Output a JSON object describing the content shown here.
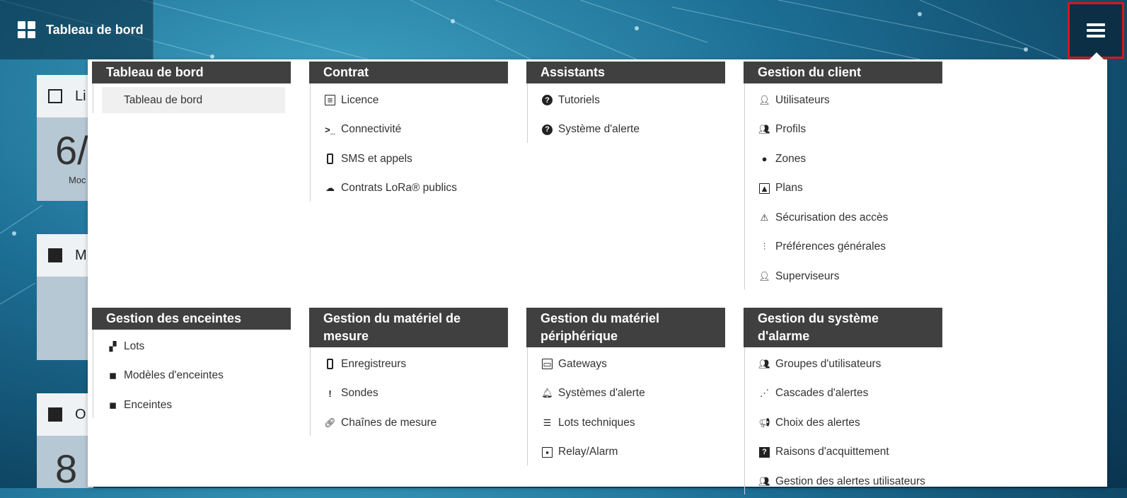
{
  "header": {
    "title": "Tableau de bord",
    "menu_icon": "hamburger-icon"
  },
  "background_cards": [
    {
      "label": "Li",
      "big": "6/",
      "sub": "Moc"
    },
    {
      "label": "M",
      "big": "",
      "sub": ""
    },
    {
      "label": "O",
      "big": "8",
      "sub": ""
    }
  ],
  "menu": {
    "sections": [
      {
        "title": "Tableau de bord",
        "items": [
          {
            "label": "Tableau de bord",
            "icon": "dashboard-icon",
            "active": true
          }
        ]
      },
      {
        "title": "Contrat",
        "items": [
          {
            "label": "Licence",
            "icon": "list-icon"
          },
          {
            "label": "Connectivité",
            "icon": "terminal-icon"
          },
          {
            "label": "SMS et appels",
            "icon": "phone-icon"
          },
          {
            "label": "Contrats LoRa® publics",
            "icon": "cloud-upload-icon"
          }
        ]
      },
      {
        "title": "Assistants",
        "items": [
          {
            "label": "Tutoriels",
            "icon": "question-icon"
          },
          {
            "label": "Système d'alerte",
            "icon": "question-icon"
          }
        ]
      },
      {
        "title": "Gestion du client",
        "items": [
          {
            "label": "Utilisateurs",
            "icon": "user-icon"
          },
          {
            "label": "Profils",
            "icon": "users-icon"
          },
          {
            "label": "Zones",
            "icon": "map-marker-icon"
          },
          {
            "label": "Plans",
            "icon": "image-icon"
          },
          {
            "label": "Sécurisation des accès",
            "icon": "warning-icon"
          },
          {
            "label": "Préférences générales",
            "icon": "sliders-icon"
          },
          {
            "label": "Superviseurs",
            "icon": "user-icon"
          }
        ]
      },
      {
        "title": "Gestion des enceintes",
        "items": [
          {
            "label": "Lots",
            "icon": "lots-icon"
          },
          {
            "label": "Modèles d'enceintes",
            "icon": "enclosure-icon"
          },
          {
            "label": "Enceintes",
            "icon": "enclosure-icon"
          }
        ]
      },
      {
        "title": "Gestion du matériel de mesure",
        "items": [
          {
            "label": "Enregistreurs",
            "icon": "recorder-icon"
          },
          {
            "label": "Sondes",
            "icon": "probe-icon"
          },
          {
            "label": "Chaînes de mesure",
            "icon": "link-icon"
          }
        ]
      },
      {
        "title": "Gestion du matériel périphérique",
        "items": [
          {
            "label": "Gateways",
            "icon": "gateway-icon"
          },
          {
            "label": "Systèmes d'alerte",
            "icon": "bell-icon"
          },
          {
            "label": "Lots techniques",
            "icon": "list-icon"
          },
          {
            "label": "Relay/Alarm",
            "icon": "relay-icon"
          }
        ]
      },
      {
        "title": "Gestion du système d'alarme",
        "items": [
          {
            "label": "Groupes d'utilisateurs",
            "icon": "users-icon"
          },
          {
            "label": "Cascades d'alertes",
            "icon": "cascade-icon"
          },
          {
            "label": "Choix des alertes",
            "icon": "bullhorn-icon"
          },
          {
            "label": "Raisons d'acquittement",
            "icon": "question-square-icon"
          },
          {
            "label": "Gestion des alertes utilisateurs",
            "icon": "users-icon"
          }
        ]
      }
    ]
  }
}
